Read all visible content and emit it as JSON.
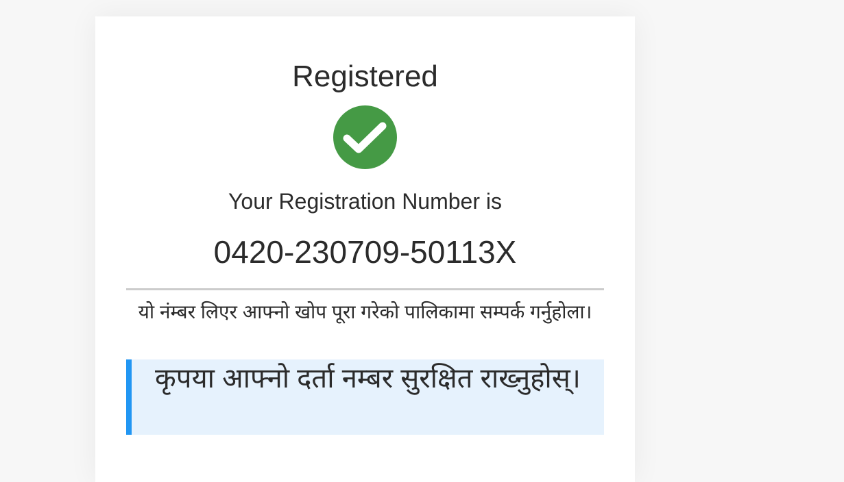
{
  "result": {
    "title": "Registered",
    "status_icon": "check-circle-icon",
    "subtitle": "Your Registration Number is",
    "registration_number": "0420-230709-50113X",
    "note": "यो नंम्बर लिएर आफ्नो खोप पूरा गरेको पालिकामा सम्पर्क गर्नुहोला।",
    "notice": "कृपया आफ्नो दर्ता नम्बर सुरक्षित राख्नुहोस्।"
  },
  "colors": {
    "success": "#459a45",
    "notice_bg": "#e6f2fd",
    "notice_border": "#2196f3",
    "divider": "#cccccc"
  }
}
